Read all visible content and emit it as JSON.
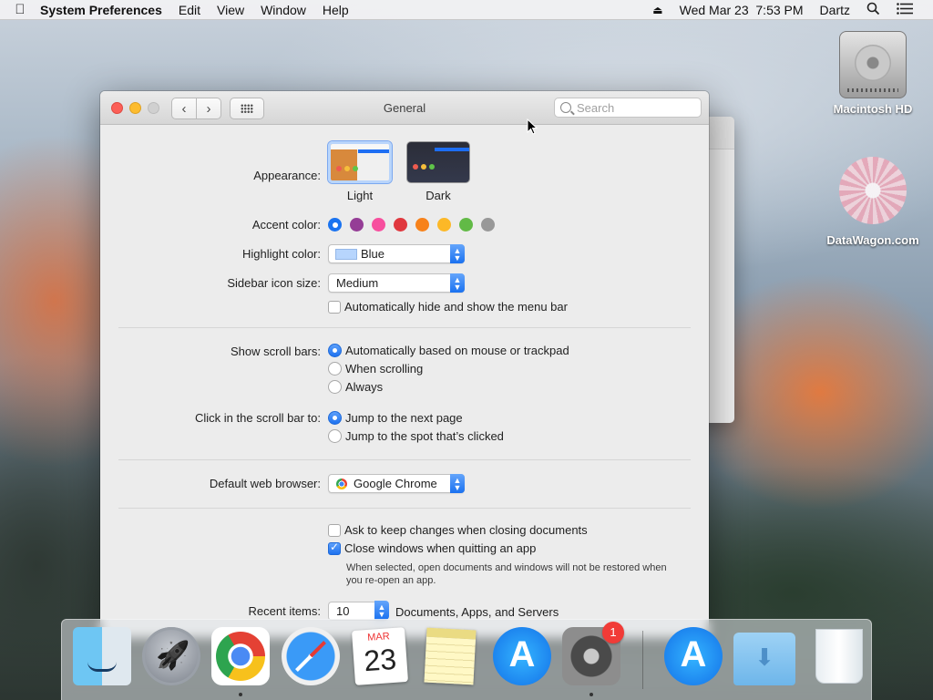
{
  "menubar": {
    "app_name": "System Preferences",
    "menus": [
      "Edit",
      "View",
      "Window",
      "Help"
    ],
    "datetime": "Wed Mar 23  7:53 PM",
    "user": "Dartz"
  },
  "desktop": {
    "icons": [
      {
        "label": "Macintosh HD",
        "icon": "hard-drive-icon"
      },
      {
        "label": "DataWagon.com",
        "icon": "flower-icon"
      }
    ]
  },
  "window": {
    "title": "General",
    "search_placeholder": "Search",
    "appearance": {
      "label": "Appearance:",
      "options": [
        {
          "caption": "Light",
          "selected": true
        },
        {
          "caption": "Dark",
          "selected": false
        }
      ]
    },
    "accent": {
      "label": "Accent color:",
      "colors": [
        "#1a73f0",
        "#953d96",
        "#f74f9e",
        "#e0383e",
        "#f7821b",
        "#fcb827",
        "#62ba46",
        "#989898"
      ],
      "selected_index": 0
    },
    "highlight": {
      "label": "Highlight color:",
      "value": "Blue"
    },
    "sidebar_icon": {
      "label": "Sidebar icon size:",
      "value": "Medium"
    },
    "auto_hide_menu": {
      "label": "Automatically hide and show the menu bar",
      "checked": false
    },
    "scroll_bars": {
      "label": "Show scroll bars:",
      "options": [
        {
          "label": "Automatically based on mouse or trackpad",
          "selected": true
        },
        {
          "label": "When scrolling",
          "selected": false
        },
        {
          "label": "Always",
          "selected": false
        }
      ]
    },
    "click_scroll": {
      "label": "Click in the scroll bar to:",
      "options": [
        {
          "label": "Jump to the next page",
          "selected": true
        },
        {
          "label": "Jump to the spot that’s clicked",
          "selected": false
        }
      ]
    },
    "browser": {
      "label": "Default web browser:",
      "value": "Google Chrome"
    },
    "ask_keep": {
      "label": "Ask to keep changes when closing documents",
      "checked": false
    },
    "close_windows": {
      "label": "Close windows when quitting an app",
      "checked": true
    },
    "note": "When selected, open documents and windows will not be restored when you re-open an app.",
    "recent": {
      "label": "Recent items:",
      "value": "10",
      "suffix": "Documents, Apps, and Servers"
    }
  },
  "calendar": {
    "month": "MAR",
    "day": "23"
  },
  "dock": {
    "apps": [
      "Finder",
      "Launchpad",
      "Google Chrome",
      "Safari",
      "Calendar",
      "Notes",
      "App Store",
      "System Preferences",
      "App Store Downloads",
      "Downloads",
      "Trash"
    ],
    "sysprefs_badge": "1"
  }
}
